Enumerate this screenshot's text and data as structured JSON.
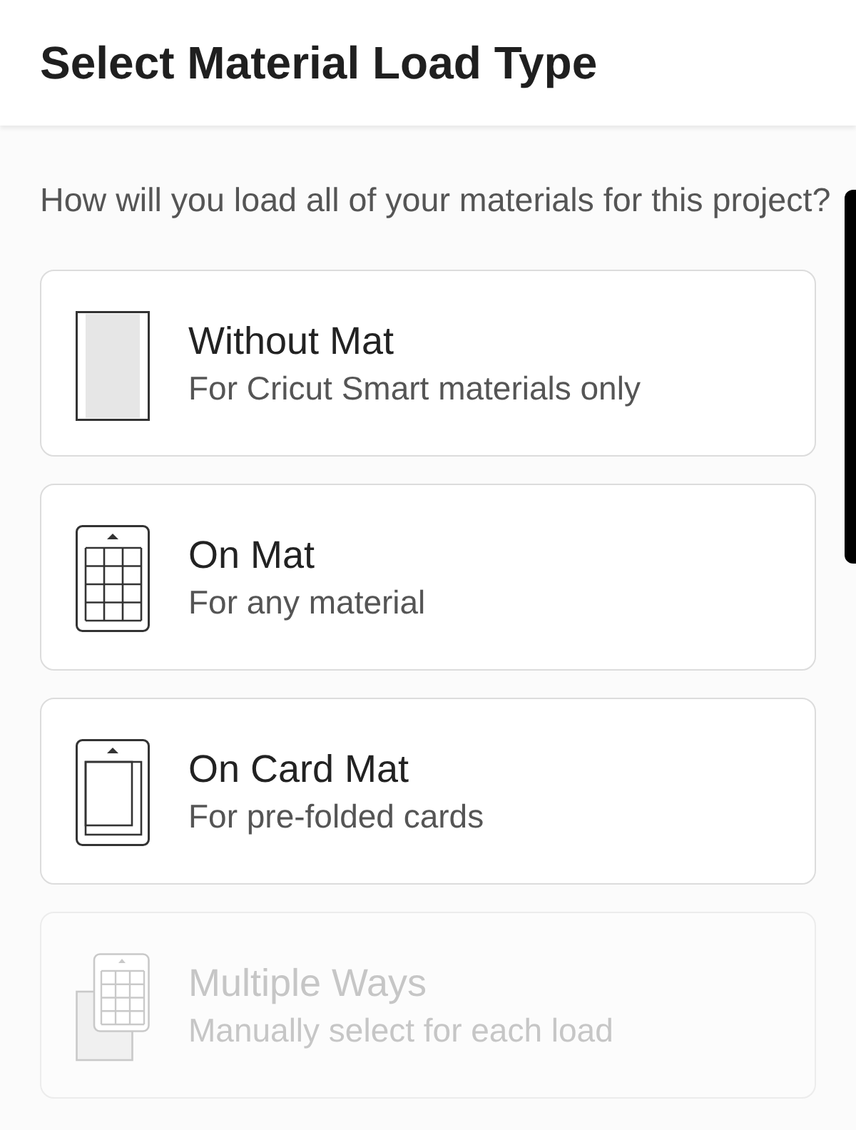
{
  "header": {
    "title": "Select Material Load Type"
  },
  "prompt": "How will you load all of your materials for this project?",
  "options": [
    {
      "kind": "no-mat",
      "title": "Without Mat",
      "subtitle": "For Cricut Smart materials only",
      "disabled": false
    },
    {
      "kind": "mat",
      "title": "On Mat",
      "subtitle": "For any material",
      "disabled": false
    },
    {
      "kind": "card-mat",
      "title": "On Card Mat",
      "subtitle": "For pre-folded cards",
      "disabled": false
    },
    {
      "kind": "multiple",
      "title": "Multiple Ways",
      "subtitle": "Manually select for each load",
      "disabled": true
    }
  ]
}
